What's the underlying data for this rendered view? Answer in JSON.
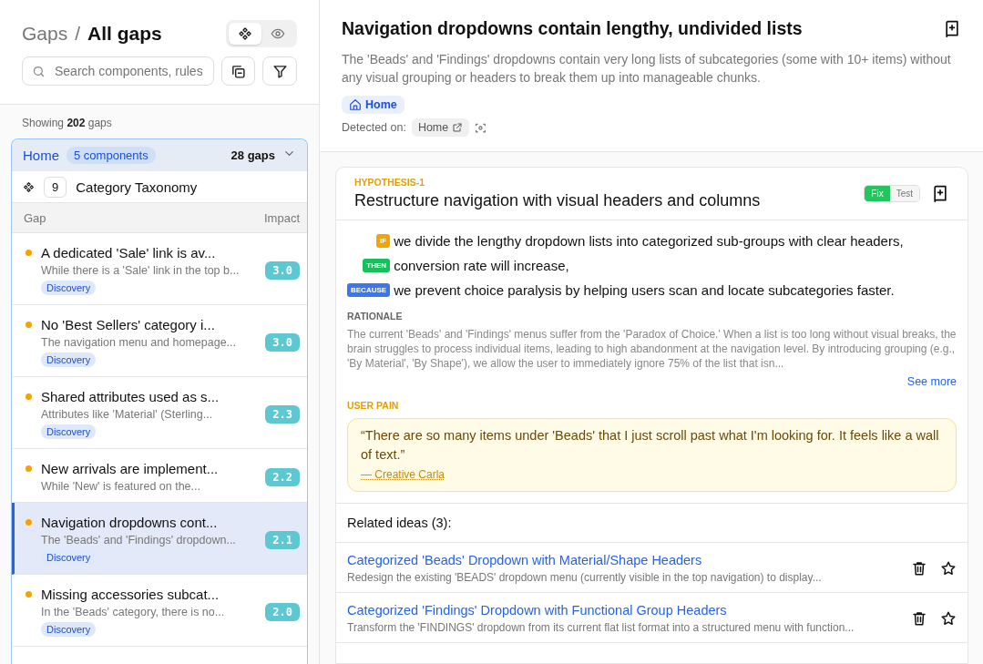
{
  "header": {
    "crumb": "Gaps",
    "separator": "/",
    "title": "All gaps",
    "view_toggle": [
      {
        "kind": "components",
        "selected": true
      },
      {
        "kind": "eye",
        "selected": false
      }
    ]
  },
  "search": {
    "placeholder": "Search components, rules"
  },
  "count": {
    "prefix": "Showing",
    "number": "202",
    "suffix": "gaps"
  },
  "group": {
    "name": "Home",
    "badge": "5 components",
    "gaps": "28 gaps",
    "expanded": true,
    "component": {
      "count": "9",
      "name": "Category Taxonomy"
    },
    "columns": [
      "Gap",
      "Impact"
    ],
    "rows": [
      {
        "title": "A dedicated 'Sale' link is av...",
        "desc": "While there is a 'Sale' link in the top b...",
        "tag": "Discovery",
        "impact": "3.0",
        "selected": false
      },
      {
        "title": "No 'Best Sellers' category i...",
        "desc": "The navigation menu and homepage...",
        "tag": "Discovery",
        "impact": "3.0",
        "selected": false
      },
      {
        "title": "Shared attributes used as s...",
        "desc": "Attributes like 'Material' (Sterling...",
        "tag": "Discovery",
        "impact": "2.3",
        "selected": false
      },
      {
        "title": "New arrivals are implement...",
        "desc": "While 'New' is featured on the...",
        "impact": "2.2",
        "selected": false
      },
      {
        "title": "Navigation dropdowns cont...",
        "desc": "The 'Beads' and 'Findings' dropdown...",
        "tag": "Discovery",
        "impact": "2.1",
        "selected": true
      },
      {
        "title": "Missing accessories subcat...",
        "desc": "In the 'Beads' category, there is no...",
        "tag": "Discovery",
        "impact": "2.0",
        "selected": false
      }
    ]
  },
  "detail": {
    "title": "Navigation dropdowns contain lengthy, undivided lists",
    "description": "The 'Beads' and 'Findings' dropdowns contain very long lists of subcategories (some with 10+ items) without any visual grouping or headers to break them up into manageable chunks.",
    "page_tag": "Home",
    "detected_label": "Detected on:",
    "detected_page": "Home"
  },
  "hypothesis": {
    "label": "HYPOTHESIS-1",
    "title": "Restructure navigation with visual headers and columns",
    "modes": [
      {
        "label": "Fix",
        "selected": true
      },
      {
        "label": "Test",
        "selected": false
      }
    ],
    "clauses": [
      {
        "kind": "if",
        "keyword": "IF",
        "text": "we divide the lengthy dropdown lists into categorized sub-groups with clear headers,"
      },
      {
        "kind": "then",
        "keyword": "THEN",
        "text": "conversion rate will increase,"
      },
      {
        "kind": "because",
        "keyword": "BECAUSE",
        "text": "we prevent choice paralysis by helping users scan and locate subcategories faster."
      }
    ],
    "rationale_label": "RATIONALE",
    "rationale": "The current 'Beads' and 'Findings' menus suffer from the 'Paradox of Choice.' When a list is too long without visual breaks, the brain struggles to process individual items, leading to high abandonment at the navigation level. By introducing grouping (e.g., 'By Material', 'By Shape'), we allow the user to immediately ignore 75% of the list that isn...",
    "see_more": "See more",
    "pain_label": "USER PAIN",
    "quote": "“There are so many items under 'Beads' that I just scroll past what I'm looking for. It feels like a wall of text.”",
    "persona": "— Creative Carla",
    "related_label": "Related ideas (3):",
    "ideas": [
      {
        "title": "Categorized 'Beads' Dropdown with Material/Shape Headers",
        "desc": "Redesign the existing 'BEADS' dropdown menu (currently visible in the top navigation) to display..."
      },
      {
        "title": "Categorized 'Findings' Dropdown with Functional Group Headers",
        "desc": "Transform the 'FINDINGS' dropdown from its current flat list format into a structured menu with function..."
      }
    ]
  }
}
